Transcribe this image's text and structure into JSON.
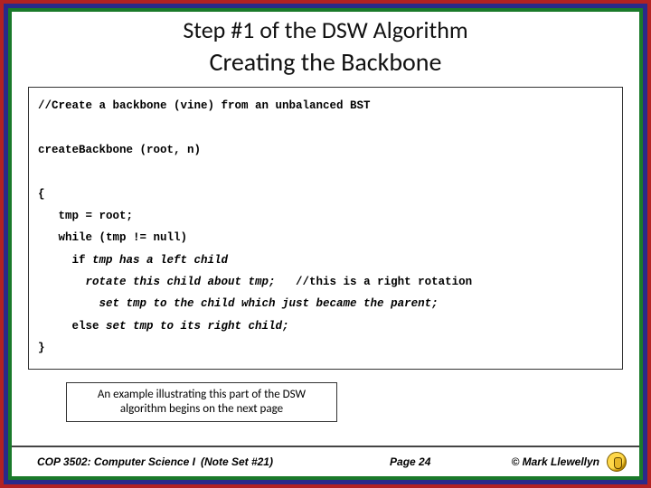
{
  "title": {
    "line1": "Step #1 of the DSW Algorithm",
    "line2": "Creating the Backbone"
  },
  "code": {
    "l1": "//Create a backbone (vine) from an unbalanced BST",
    "l2": "createBackbone (root, n)",
    "l3": "{",
    "l4": "   tmp = root;",
    "l5": "   while (tmp != null)",
    "l6a": "     if ",
    "l6b": "tmp has a left child",
    "l7a": "       rotate this child about tmp;",
    "l7b": "   //this is a right rotation",
    "l8": "         set tmp to the child which just became the parent;",
    "l9a": "     else ",
    "l9b": "set tmp to its right child;",
    "l10": "}"
  },
  "note": "An example illustrating this part of the DSW algorithm begins on the next page",
  "footer": {
    "course": "COP 3502: Computer Science I",
    "noteset": "(Note Set #21)",
    "page": "Page 24",
    "author": "© Mark Llewellyn"
  }
}
